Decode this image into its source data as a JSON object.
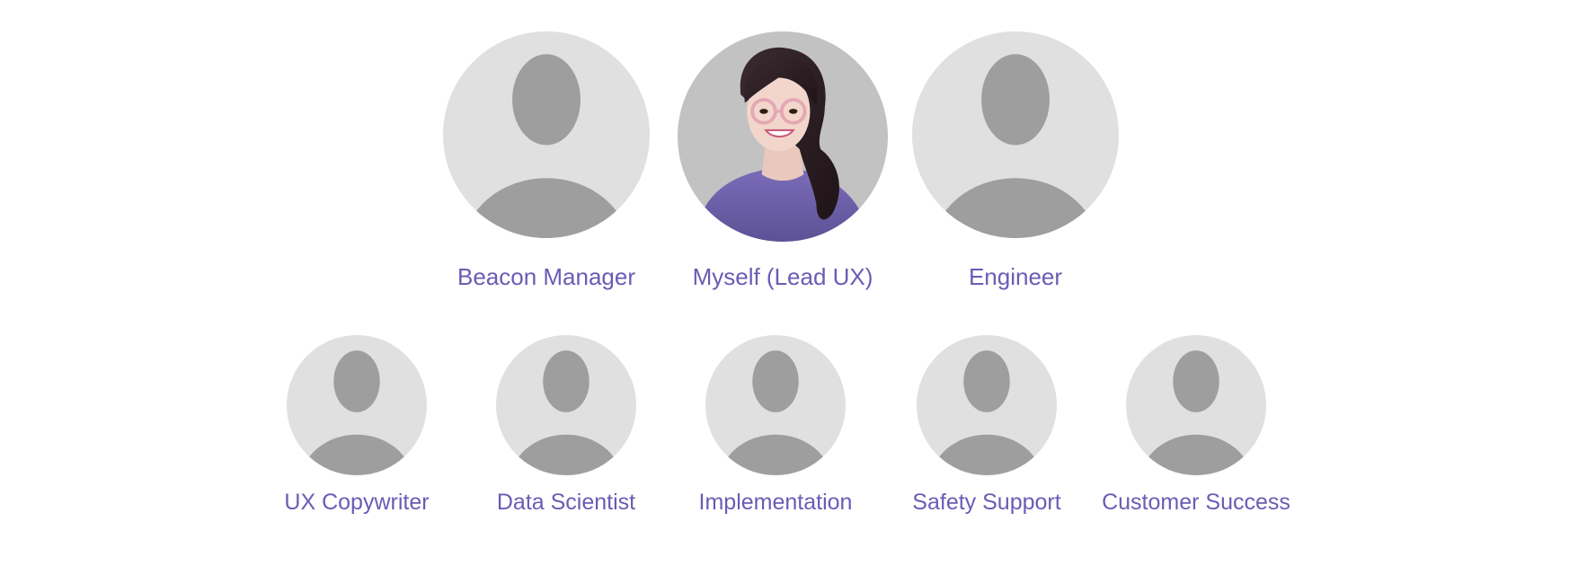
{
  "top_row": [
    {
      "id": "beacon-manager",
      "name": "Beacon Manager",
      "avatar_icon": "person-placeholder-icon"
    },
    {
      "id": "myself",
      "name": "Myself (Lead UX)",
      "avatar_icon": "user-portrait-icon"
    },
    {
      "id": "engineer",
      "name": "Engineer",
      "avatar_icon": "person-placeholder-icon"
    }
  ],
  "bottom_row": [
    {
      "id": "ux-copywriter",
      "name": "UX Copywriter",
      "avatar_icon": "person-placeholder-icon"
    },
    {
      "id": "data-scientist",
      "name": "Data Scientist",
      "avatar_icon": "person-placeholder-icon"
    },
    {
      "id": "implementation",
      "name": "Implementation",
      "avatar_icon": "person-placeholder-icon"
    },
    {
      "id": "safety-support",
      "name": "Safety Support",
      "avatar_icon": "person-placeholder-icon"
    },
    {
      "id": "customer-success",
      "name": "Customer Success",
      "avatar_icon": "person-placeholder-icon"
    }
  ],
  "colors": {
    "label": "#6a5cb5",
    "placeholder_bg": "#e0e0e0",
    "placeholder_figure": "#9e9e9e",
    "portrait_bg": "#c2c2c2",
    "shirt": "#655a9c"
  }
}
